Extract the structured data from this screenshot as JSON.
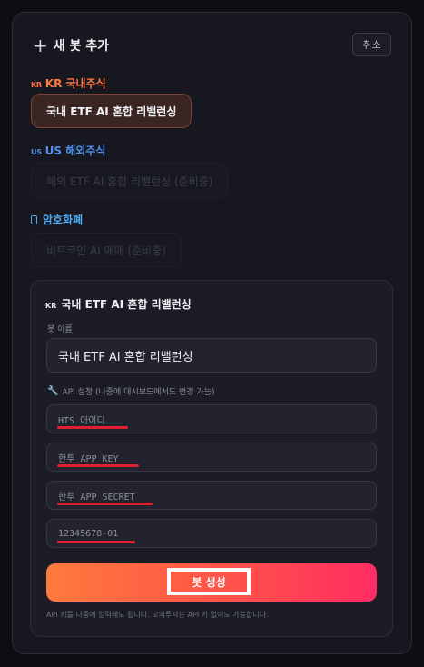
{
  "header": {
    "title": "새 봇 추가",
    "cancel_label": "취소"
  },
  "sections": {
    "kr": {
      "flag": "KR",
      "label": "KR 국내주식",
      "bot": "국내 ETF AI 혼합 리밸런싱"
    },
    "us": {
      "flag": "US",
      "label": "US 해외주식",
      "bot": "해외 ETF AI 혼합 리밸런싱 (준비중)"
    },
    "crypto": {
      "label": "암호화폐",
      "bot": "비트코인 AI 매매 (준비중)"
    }
  },
  "card": {
    "flag": "KR",
    "title": "국내 ETF AI 혼합 리밸런싱",
    "bot_name_label": "봇 이름",
    "bot_name_value": "국내 ETF AI 혼합 리밸런싱",
    "api_label": "API 설정 (나중에 대시보드에서도 변경 가능)",
    "hts_id_placeholder": "HTS 아이디",
    "app_key_placeholder": "한투 APP KEY",
    "app_secret_placeholder": "한투 APP SECRET",
    "account_placeholder": "12345678-01",
    "create_label": "봇 생성",
    "help_text": "API 키를 나중에 입력해도 됩니다. 모의투자는 API 키 없이도 가능합니다."
  },
  "colors": {
    "accent_kr": "#ff7a45",
    "accent_us": "#4f8fe8",
    "button_gradient_start": "#ff7a3d",
    "button_gradient_end": "#ff2d63",
    "annotation_red": "#e0202f"
  }
}
